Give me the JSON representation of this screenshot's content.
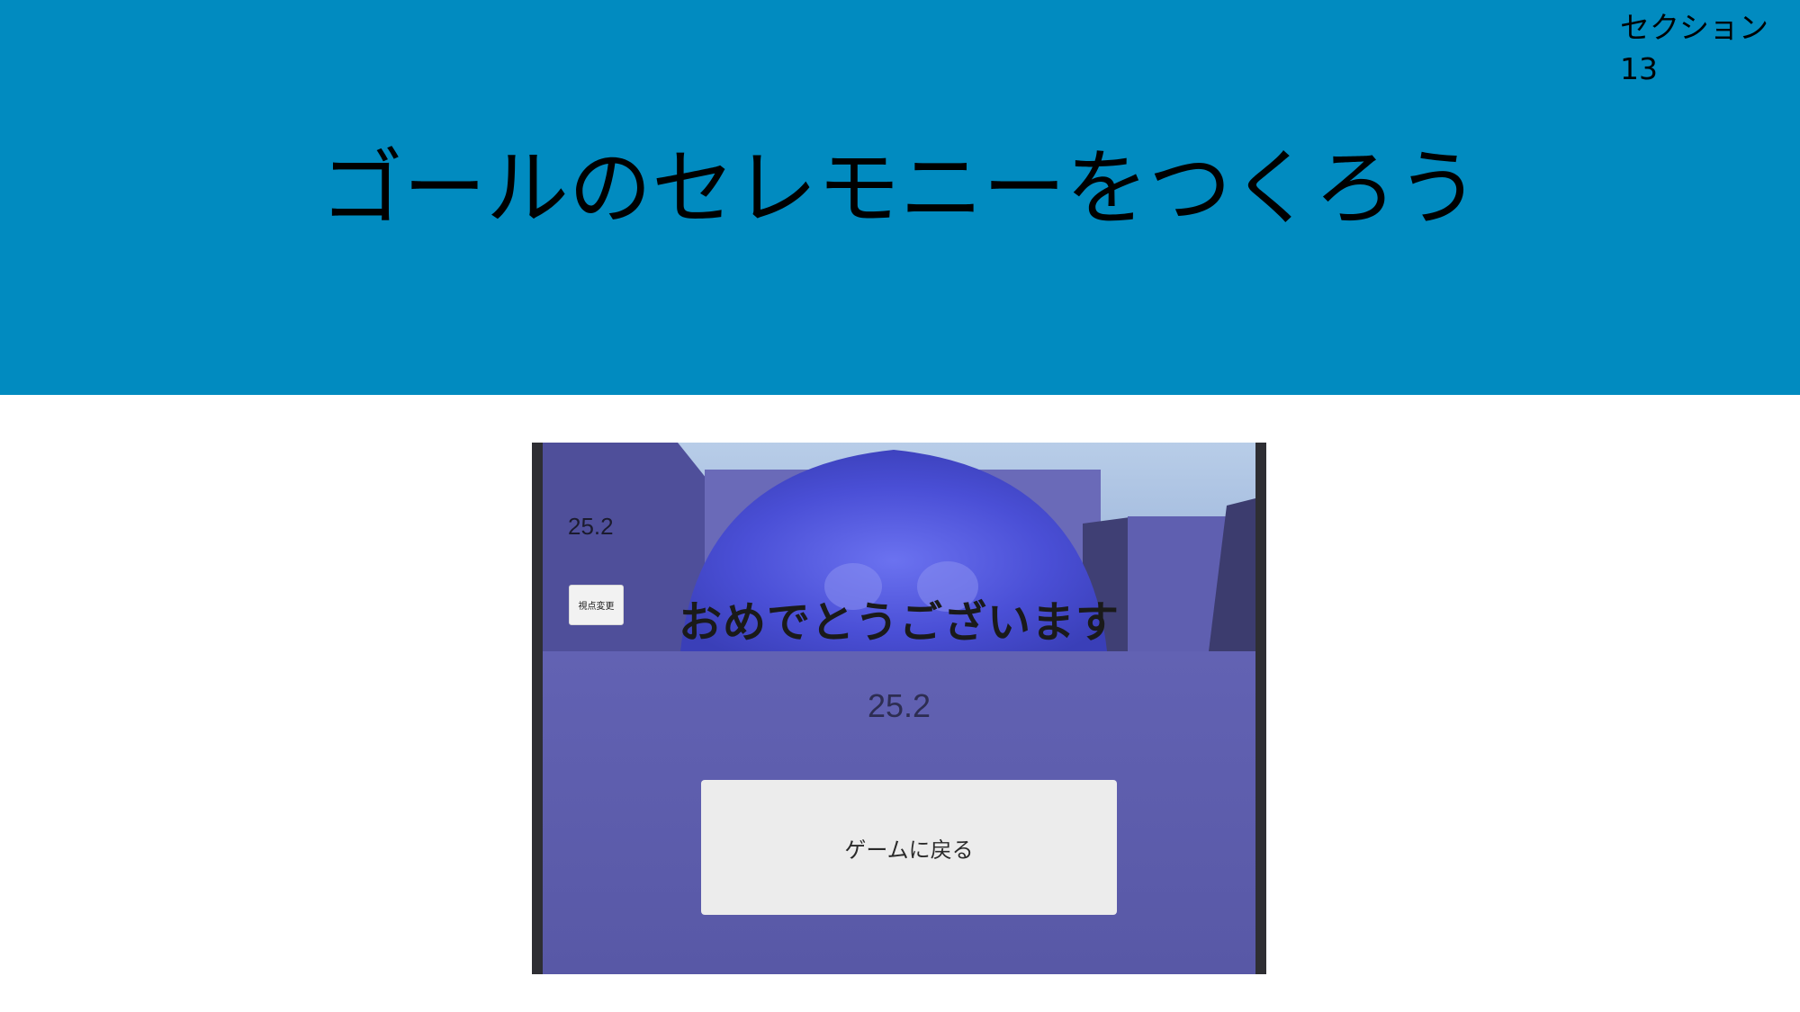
{
  "section": {
    "line1": "セクション",
    "line2": "13"
  },
  "slide_title": "ゴールのセレモニーをつくろう",
  "game": {
    "timer": "25.2",
    "view_change_label": "視点変更",
    "congrats": "おめでとうございます",
    "score": "25.2",
    "return_button": "ゲームに戻る"
  },
  "colors": {
    "header": "#018bc0",
    "panel": "#5e5eae",
    "ball": "#4a4fd6"
  }
}
